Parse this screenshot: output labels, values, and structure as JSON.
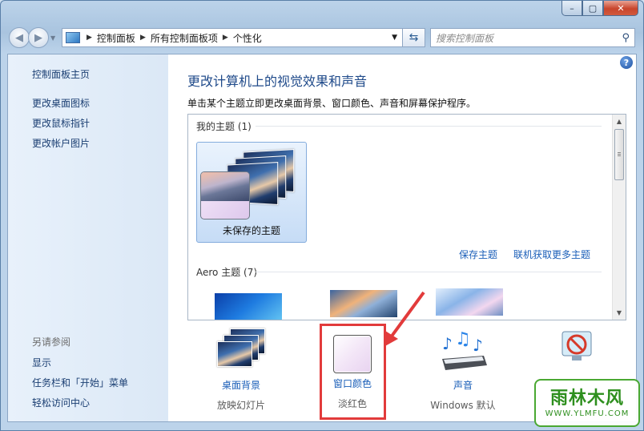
{
  "window": {
    "minimize_glyph": "–",
    "maximize_glyph": "▢",
    "close_glyph": "✕"
  },
  "address_bar": {
    "breadcrumbs": [
      "控制面板",
      "所有控制面板项",
      "个性化"
    ],
    "search_placeholder": "搜索控制面板"
  },
  "sidebar": {
    "home_link": "控制面板主页",
    "links": [
      "更改桌面图标",
      "更改鼠标指针",
      "更改帐户图片"
    ],
    "see_also_header": "另请参阅",
    "see_also_links": [
      "显示",
      "任务栏和「开始」菜单",
      "轻松访问中心"
    ]
  },
  "main": {
    "help_glyph": "?",
    "title": "更改计算机上的视觉效果和声音",
    "description": "单击某个主题立即更改桌面背景、窗口颜色、声音和屏幕保护程序。",
    "my_themes_group": "我的主题 (1)",
    "unsaved_theme_label": "未保存的主题",
    "save_theme_link": "保存主题",
    "get_more_themes_link": "联机获取更多主题",
    "aero_group": "Aero 主题 (7)"
  },
  "bottom": {
    "desktop_background": {
      "title": "桌面背景",
      "subtitle": "放映幻灯片"
    },
    "window_color": {
      "title": "窗口颜色",
      "subtitle": "淡红色"
    },
    "sounds": {
      "title": "声音",
      "subtitle": "Windows 默认"
    }
  },
  "watermark": {
    "brand": "雨林木风",
    "url": "WWW.YLMFU.COM"
  },
  "colors": {
    "link": "#1a5eb8",
    "highlight": "#e23b3b",
    "title": "#1f4a8a"
  }
}
